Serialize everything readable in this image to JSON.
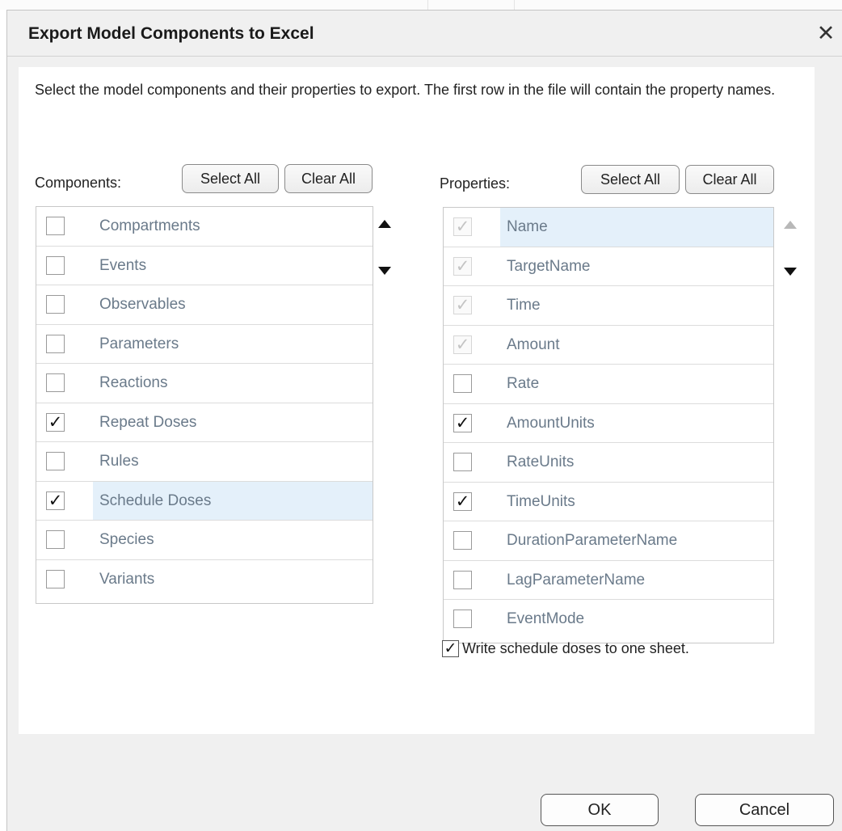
{
  "dialog": {
    "title": "Export Model Components to Excel",
    "close_glyph": "✕",
    "description": "Select the model components and their properties to export. The first row in the file will contain the property names."
  },
  "components": {
    "label": "Components:",
    "select_all": "Select All",
    "clear_all": "Clear All",
    "items": [
      {
        "label": "Compartments",
        "checked": false,
        "selected": false
      },
      {
        "label": "Events",
        "checked": false,
        "selected": false
      },
      {
        "label": "Observables",
        "checked": false,
        "selected": false
      },
      {
        "label": "Parameters",
        "checked": false,
        "selected": false
      },
      {
        "label": "Reactions",
        "checked": false,
        "selected": false
      },
      {
        "label": "Repeat Doses",
        "checked": true,
        "selected": false
      },
      {
        "label": "Rules",
        "checked": false,
        "selected": false
      },
      {
        "label": "Schedule Doses",
        "checked": true,
        "selected": true
      },
      {
        "label": "Species",
        "checked": false,
        "selected": false
      },
      {
        "label": "Variants",
        "checked": false,
        "selected": false
      }
    ]
  },
  "properties": {
    "label": "Properties:",
    "select_all": "Select All",
    "clear_all": "Clear All",
    "items": [
      {
        "label": "Name",
        "checked": true,
        "disabled": true,
        "selected": true
      },
      {
        "label": "TargetName",
        "checked": true,
        "disabled": true,
        "selected": false
      },
      {
        "label": "Time",
        "checked": true,
        "disabled": true,
        "selected": false
      },
      {
        "label": "Amount",
        "checked": true,
        "disabled": true,
        "selected": false
      },
      {
        "label": "Rate",
        "checked": false,
        "disabled": false,
        "selected": false
      },
      {
        "label": "AmountUnits",
        "checked": true,
        "disabled": false,
        "selected": false
      },
      {
        "label": "RateUnits",
        "checked": false,
        "disabled": false,
        "selected": false
      },
      {
        "label": "TimeUnits",
        "checked": true,
        "disabled": false,
        "selected": false
      },
      {
        "label": "DurationParameterName",
        "checked": false,
        "disabled": false,
        "selected": false
      },
      {
        "label": "LagParameterName",
        "checked": false,
        "disabled": false,
        "selected": false
      },
      {
        "label": "EventMode",
        "checked": false,
        "disabled": false,
        "selected": false
      }
    ]
  },
  "write_one_sheet": {
    "label": "Write schedule doses to one sheet.",
    "checked": true
  },
  "footer": {
    "ok": "OK",
    "cancel": "Cancel"
  },
  "glyphs": {
    "check": "✓"
  }
}
